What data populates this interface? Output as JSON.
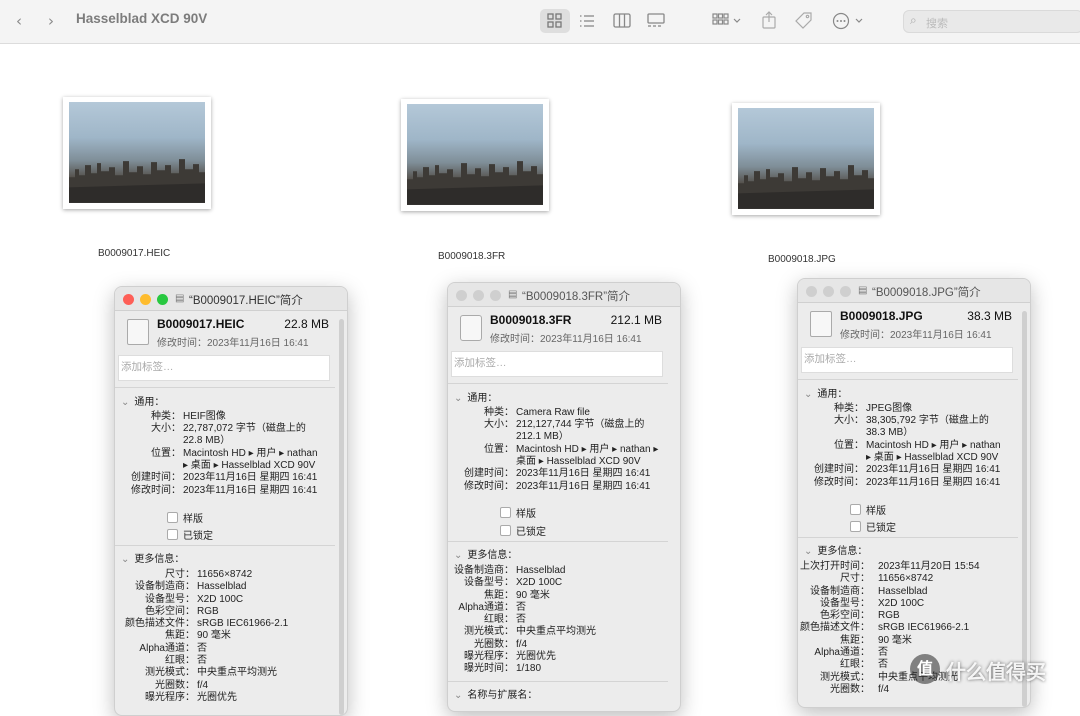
{
  "window": {
    "title": "Hasselblad XCD 90V",
    "search_placeholder": "搜索"
  },
  "toolbar_icons": [
    "back-icon",
    "forward-icon",
    "icon-view-icon",
    "list-view-icon",
    "column-view-icon",
    "gallery-view-icon",
    "group-icon",
    "share-icon",
    "tag-icon",
    "more-icon",
    "search-icon"
  ],
  "files": [
    {
      "name": "B0009017.HEIC"
    },
    {
      "name": "B0009018.3FR"
    },
    {
      "name": "B0009018.JPG"
    }
  ],
  "panels": [
    {
      "title": "“B0009017.HEIC”简介",
      "name": "B0009017.HEIC",
      "size": "22.8 MB",
      "modified": "修改时间：2023年11月16日 16:41",
      "tags_placeholder": "添加标签…",
      "general_label": "通用：",
      "general": [
        {
          "k": "种类：",
          "v": "HEIF图像"
        },
        {
          "k": "大小：",
          "v": "22,787,072 字节（磁盘上的"
        },
        {
          "k": "",
          "v": "22.8 MB）"
        },
        {
          "k": "位置：",
          "v": "Macintosh HD ▸ 用户 ▸ nathan"
        },
        {
          "k": "",
          "v": "▸ 桌面 ▸ Hasselblad XCD 90V"
        },
        {
          "k": "创建时间：",
          "v": "2023年11月16日 星期四 16:41"
        },
        {
          "k": "修改时间：",
          "v": "2023年11月16日 星期四 16:41"
        }
      ],
      "checkbox_stationery": "样版",
      "checkbox_locked": "已锁定",
      "more_label": "更多信息：",
      "more": [
        {
          "k": "尺寸：",
          "v": "11656×8742"
        },
        {
          "k": "设备制造商：",
          "v": "Hasselblad"
        },
        {
          "k": "设备型号：",
          "v": "X2D 100C"
        },
        {
          "k": "色彩空间：",
          "v": "RGB"
        },
        {
          "k": "颜色描述文件：",
          "v": "sRGB IEC61966-2.1"
        },
        {
          "k": "焦距：",
          "v": "90 毫米"
        },
        {
          "k": "Alpha通道：",
          "v": "否"
        },
        {
          "k": "红眼：",
          "v": "否"
        },
        {
          "k": "测光模式：",
          "v": "中央重点平均测光"
        },
        {
          "k": "光圈数：",
          "v": "f/4"
        },
        {
          "k": "曝光程序：",
          "v": "光圈优先"
        }
      ]
    },
    {
      "title": "“B0009018.3FR”简介",
      "name": "B0009018.3FR",
      "size": "212.1 MB",
      "modified": "修改时间：2023年11月16日 16:41",
      "tags_placeholder": "添加标签…",
      "general_label": "通用：",
      "general": [
        {
          "k": "种类：",
          "v": "Camera Raw file"
        },
        {
          "k": "大小：",
          "v": "212,127,744 字节（磁盘上的"
        },
        {
          "k": "",
          "v": "212.1 MB）"
        },
        {
          "k": "位置：",
          "v": "Macintosh HD ▸ 用户 ▸ nathan ▸"
        },
        {
          "k": "",
          "v": "桌面 ▸ Hasselblad XCD 90V"
        },
        {
          "k": "创建时间：",
          "v": "2023年11月16日 星期四 16:41"
        },
        {
          "k": "修改时间：",
          "v": "2023年11月16日 星期四 16:41"
        }
      ],
      "checkbox_stationery": "样版",
      "checkbox_locked": "已锁定",
      "more_label": "更多信息：",
      "more": [
        {
          "k": "设备制造商：",
          "v": "Hasselblad"
        },
        {
          "k": "设备型号：",
          "v": "X2D 100C"
        },
        {
          "k": "焦距：",
          "v": "90 毫米"
        },
        {
          "k": "Alpha通道：",
          "v": "否"
        },
        {
          "k": "红眼：",
          "v": "否"
        },
        {
          "k": "测光模式：",
          "v": "中央重点平均测光"
        },
        {
          "k": "光圈数：",
          "v": "f/4"
        },
        {
          "k": "曝光程序：",
          "v": "光圈优先"
        },
        {
          "k": "曝光时间：",
          "v": "1/180"
        }
      ],
      "name_ext_label": "名称与扩展名："
    },
    {
      "title": "“B0009018.JPG”简介",
      "name": "B0009018.JPG",
      "size": "38.3 MB",
      "modified": "修改时间：2023年11月16日 16:41",
      "tags_placeholder": "添加标签…",
      "general_label": "通用：",
      "general": [
        {
          "k": "种类：",
          "v": "JPEG图像"
        },
        {
          "k": "大小：",
          "v": "38,305,792 字节（磁盘上的"
        },
        {
          "k": "",
          "v": "38.3 MB）"
        },
        {
          "k": "位置：",
          "v": "Macintosh HD ▸ 用户 ▸ nathan"
        },
        {
          "k": "",
          "v": "▸ 桌面 ▸ Hasselblad XCD 90V"
        },
        {
          "k": "创建时间：",
          "v": "2023年11月16日 星期四 16:41"
        },
        {
          "k": "修改时间：",
          "v": "2023年11月16日 星期四 16:41"
        }
      ],
      "checkbox_stationery": "样版",
      "checkbox_locked": "已锁定",
      "more_label": "更多信息：",
      "more": [
        {
          "k": "上次打开时间：",
          "v": "2023年11月20日 15:54"
        },
        {
          "k": "尺寸：",
          "v": "11656×8742"
        },
        {
          "k": "设备制造商：",
          "v": "Hasselblad"
        },
        {
          "k": "设备型号：",
          "v": "X2D 100C"
        },
        {
          "k": "色彩空间：",
          "v": "RGB"
        },
        {
          "k": "颜色描述文件：",
          "v": "sRGB IEC61966-2.1"
        },
        {
          "k": "焦距：",
          "v": "90 毫米"
        },
        {
          "k": "Alpha通道：",
          "v": "否"
        },
        {
          "k": "红眼：",
          "v": "否"
        },
        {
          "k": "测光模式：",
          "v": "中央重点平均测光"
        },
        {
          "k": "光圈数：",
          "v": "f/4"
        }
      ]
    }
  ],
  "watermark": {
    "badge": "值",
    "text": "什么值得买"
  }
}
